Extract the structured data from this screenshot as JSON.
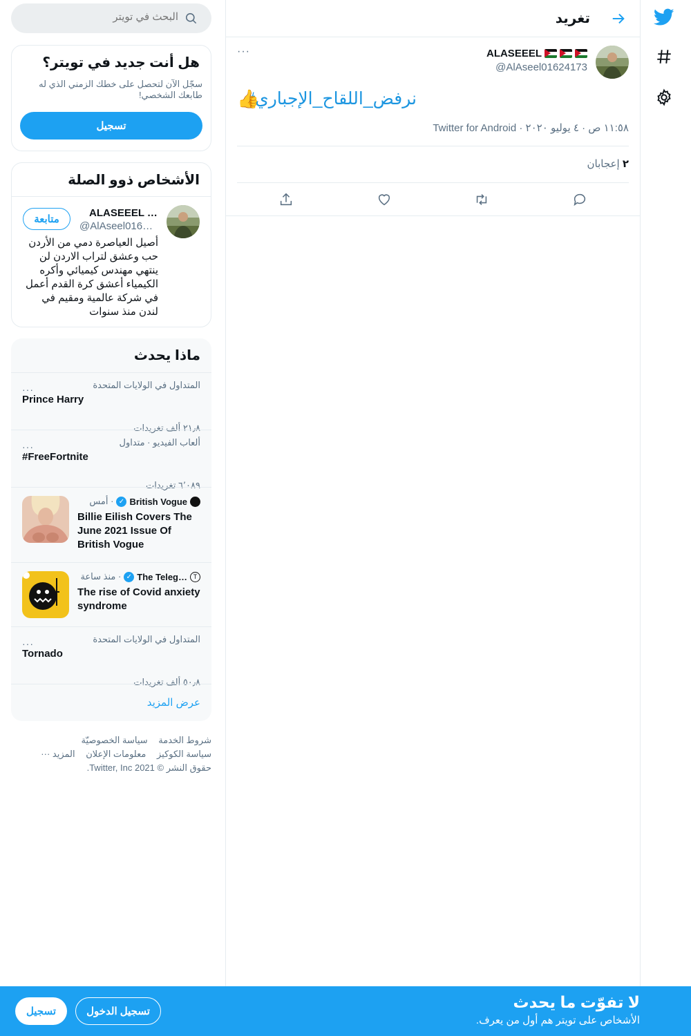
{
  "search": {
    "placeholder": "البحث في تويتر"
  },
  "header": {
    "title": "تغريد"
  },
  "tweet": {
    "author_name": "ALASEEEL",
    "author_handle": "@AlAseel01624173",
    "text": "#نرفض_اللقاح_الإجباري",
    "emoji": "👍",
    "meta": "١١:٥٨ ص · ٤ يوليو ٢٠٢٠ · Twitter for Android",
    "likes_count": "٢",
    "likes_label": "إعجابان",
    "more": "···"
  },
  "signup_card": {
    "title": "هل أنت جديد في تويتر؟",
    "desc": "سجّل الآن لتحصل على خطك الزمني الذي له طابعك الشخصي!",
    "button": "تسجيل"
  },
  "people": {
    "title": "الأشخاص ذوو الصلة",
    "name": "ALASEEEL 🇯🇴🇯🇴🇯🇴",
    "handle": "@AlAseel01624173",
    "follow": "متابعة",
    "bio": "أصيل العياصرة دمي من الأردن حب وعشق لتراب الاردن لن ينتهي مهندس كيميائي وأكره الكيمياء أعشق كرة القدم أعمل في شركة عالمية ومقيم في لندن منذ سنوات"
  },
  "trends": {
    "title": "ماذا يحدث",
    "items": [
      {
        "context": "المتداول في الولايات المتحدة",
        "name": "Prince Harry",
        "count": "٢١٫٨ ألف تغريدات"
      },
      {
        "context": "ألعاب الفيديو · متداول",
        "name": "#FreeFortnite",
        "count": "٦٬٠٨٩ تغريدات"
      },
      {
        "context": "المتداول في الولايات المتحدة",
        "name": "Tornado",
        "count": "٥٠٫٨ ألف تغريدات"
      }
    ],
    "news": [
      {
        "source": "British Vogue",
        "time": "· أمس",
        "title": "Billie Eilish Covers The June 2021 Issue Of British Vogue"
      },
      {
        "source": "The Teleg…",
        "time": "· منذ ساعة",
        "title": "The rise of Covid anxiety syndrome"
      }
    ],
    "show_more": "عرض المزيد"
  },
  "footer": {
    "terms": "شروط الخدمة",
    "privacy": "سياسة الخصوصيّة",
    "cookies": "سياسة الكوكيز",
    "ads": "معلومات الإعلان",
    "more": "المزيد ···",
    "copyright": "حقوق النشر © 2021 Twitter, Inc."
  },
  "bottom_bar": {
    "title": "لا تفوّت ما يحدث",
    "subtitle": "الأشخاص على تويتر هم أول من يعرف.",
    "login": "تسجيل الدخول",
    "signup": "تسجيل"
  },
  "colors": {
    "accent": "#1da1f2",
    "link": "#1b95e0",
    "muted": "#5b7083"
  }
}
